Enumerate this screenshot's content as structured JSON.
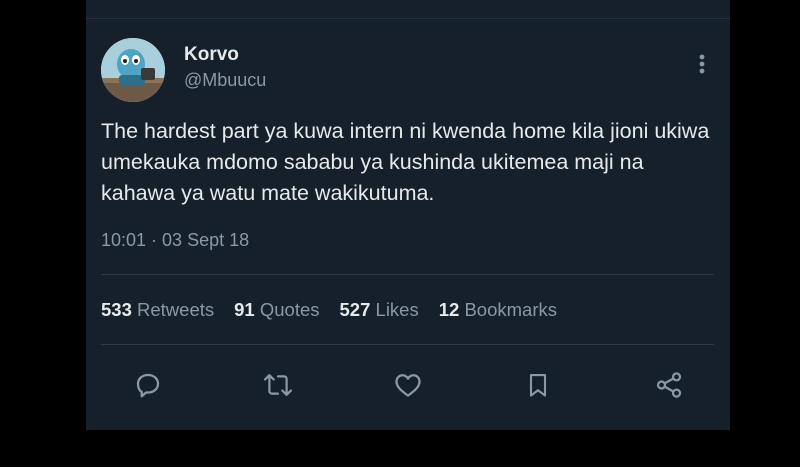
{
  "author": {
    "display_name": "Korvo",
    "handle": "@Mbuucu"
  },
  "tweet": {
    "text": "The hardest part ya kuwa intern ni kwenda home kila jioni ukiwa umekauka mdomo sababu ya kushinda ukitemea maji na kahawa ya watu mate wakikutuma.",
    "timestamp": "10:01 · 03 Sept 18"
  },
  "stats": {
    "retweets_count": "533",
    "retweets_label": "Retweets",
    "quotes_count": "91",
    "quotes_label": "Quotes",
    "likes_count": "527",
    "likes_label": "Likes",
    "bookmarks_count": "12",
    "bookmarks_label": "Bookmarks"
  },
  "actions": [
    "reply-icon",
    "retweet-icon",
    "like-icon",
    "bookmark-icon",
    "share-icon"
  ],
  "colors": {
    "background": "#000000",
    "card": "#15202b",
    "primary_text": "#e7e9ea",
    "secondary_text": "#8b98a5"
  }
}
